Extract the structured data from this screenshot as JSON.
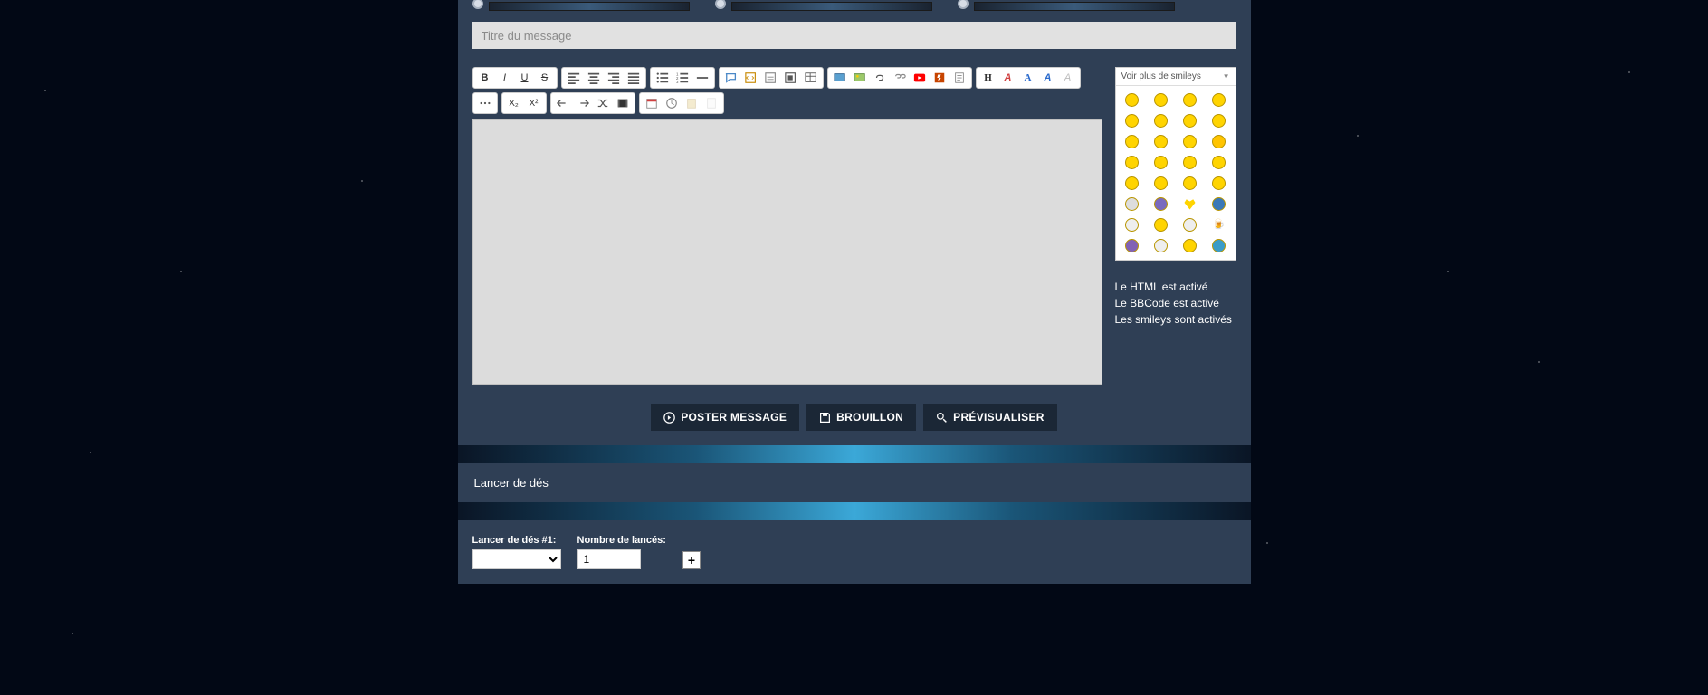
{
  "editor": {
    "title_placeholder": "Titre du message",
    "smileys_header": "Voir plus de smileys",
    "toolbar": {
      "bold": "B",
      "italic": "I",
      "underline": "U",
      "strike": "S",
      "subscript": "X₂",
      "superscript": "X²",
      "header": "H"
    }
  },
  "status": {
    "html": "Le HTML est activé",
    "bbcode": "Le BBCode est activé",
    "smileys": "Les smileys sont activés"
  },
  "buttons": {
    "post": "POSTER MESSAGE",
    "draft": "BROUILLON",
    "preview": "PRÉVISUALISER"
  },
  "dice": {
    "section_title": "Lancer de dés",
    "label1": "Lancer de dés #1:",
    "label2": "Nombre de lancés:",
    "count_value": "1",
    "plus": "+"
  }
}
